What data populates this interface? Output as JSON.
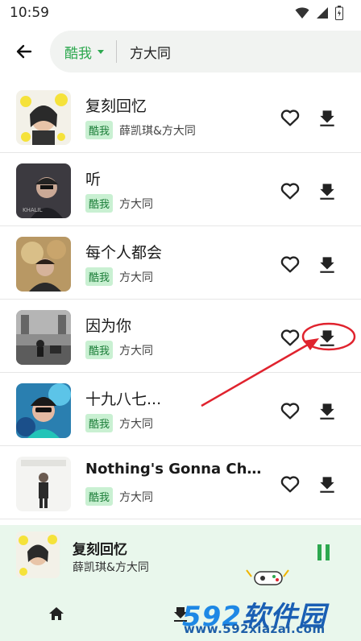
{
  "status_bar": {
    "time": "10:59"
  },
  "header": {
    "source_label": "酷我",
    "query": "方大同"
  },
  "songs": [
    {
      "title": "复刻回忆",
      "source": "酷我",
      "artist": "薛凯琪&方大同"
    },
    {
      "title": "听",
      "source": "酷我",
      "artist": "方大同"
    },
    {
      "title": "每个人都会",
      "source": "酷我",
      "artist": "方大同"
    },
    {
      "title": "因为你",
      "source": "酷我",
      "artist": "方大同"
    },
    {
      "title": "十九八七...",
      "source": "酷我",
      "artist": "方大同"
    },
    {
      "title": "Nothing's Gonna Cha...",
      "source": "酷我",
      "artist": "方大同"
    }
  ],
  "now_playing": {
    "title": "复刻回忆",
    "artist": "薛凯琪&方大同"
  },
  "watermark": {
    "brand_num": "592",
    "brand_text": "软件园",
    "url": "www.592xiazai.com"
  },
  "colors": {
    "accent": "#2da84f",
    "badge_bg": "#c9f0d2",
    "annotation": "#e0232e"
  }
}
